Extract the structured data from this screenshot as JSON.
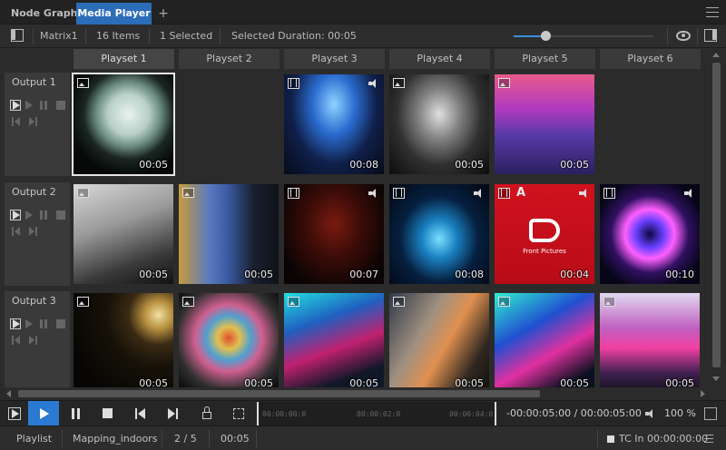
{
  "tabs": [
    {
      "label": "Node Graph",
      "active": false
    },
    {
      "label": "Media Player",
      "active": true
    }
  ],
  "tab_add_label": "+",
  "toolbar": {
    "matrix": "Matrix1",
    "items_count": "16 Items",
    "selected_count": "1 Selected",
    "selected_duration": "Selected Duration: 00:05",
    "zoom_slider_fraction": 0.23
  },
  "playsets": [
    "Playset 1",
    "Playset 2",
    "Playset 3",
    "Playset 4",
    "Playset 5",
    "Playset 6"
  ],
  "outputs": [
    {
      "label": "Output 1",
      "cells": [
        {
          "type": "image",
          "audio": false,
          "duration": "00:05",
          "selected": true,
          "thumb": "silhouette"
        },
        null,
        {
          "type": "video",
          "audio": true,
          "duration": "00:08",
          "thumb": "dancers"
        },
        {
          "type": "image",
          "audio": false,
          "duration": "00:05",
          "thumb": "wireframe"
        },
        {
          "type": "image",
          "audio": false,
          "duration": "00:05",
          "thumb": "crowd"
        }
      ]
    },
    {
      "label": "Output 2",
      "cells": [
        {
          "type": "image",
          "audio": false,
          "duration": "00:05",
          "thumb": "lines"
        },
        {
          "type": "image",
          "audio": false,
          "duration": "00:05",
          "thumb": "gallery"
        },
        {
          "type": "video",
          "audio": true,
          "duration": "00:07",
          "thumb": "dark-red"
        },
        {
          "type": "video",
          "audio": true,
          "duration": "00:08",
          "thumb": "neon-blue"
        },
        {
          "type": "video",
          "audio": true,
          "duration": "00:04",
          "thumb": "logo-red",
          "alpha": true,
          "alpha_label": "A",
          "logo_caption": "Front Pictures"
        },
        {
          "type": "video",
          "audio": true,
          "duration": "00:10",
          "thumb": "tunnel"
        }
      ]
    },
    {
      "label": "Output 3",
      "cells": [
        {
          "type": "image",
          "audio": false,
          "duration": "00:05",
          "thumb": "moon"
        },
        {
          "type": "image",
          "audio": false,
          "duration": "00:05",
          "thumb": "dome"
        },
        {
          "type": "image",
          "audio": false,
          "duration": "00:05",
          "thumb": "neon-room"
        },
        {
          "type": "image",
          "audio": false,
          "duration": "00:05",
          "thumb": "venus"
        },
        {
          "type": "image",
          "audio": false,
          "duration": "00:05",
          "thumb": "neon-room2"
        },
        {
          "type": "image",
          "audio": false,
          "duration": "00:05",
          "thumb": "train"
        }
      ]
    }
  ],
  "transport": {
    "timeline_labels": [
      "00:00:00:0",
      "00:00:02:0",
      "00:00:04:0"
    ],
    "timecode": "-00:00:05:00 / 00:00:05:00",
    "volume": "100 %"
  },
  "status": {
    "mode": "Playlist",
    "project": "Mapping_indoors",
    "position": "2 / 5",
    "duration": "00:05",
    "tc_label": "TC In",
    "tc_value": "00:00:00:00"
  },
  "colors": {
    "accent": "#2a7ad2",
    "panel": "#2b2b2b",
    "header": "#3a3a3a"
  }
}
